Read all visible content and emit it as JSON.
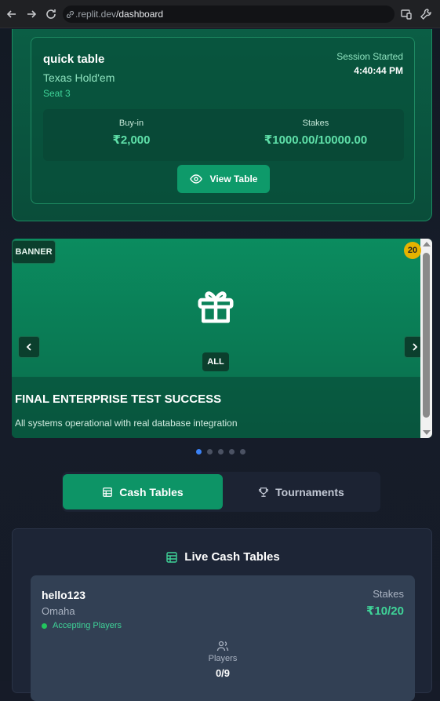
{
  "browser": {
    "url_host": ".replit.dev",
    "url_path": "/dashboard"
  },
  "session": {
    "table_name": "quick table",
    "game_type": "Texas Hold'em",
    "seat": "Seat 3",
    "started_label": "Session Started",
    "started_time": "4:40:44 PM",
    "buyin_label": "Buy-in",
    "buyin_value": "₹2,000",
    "stakes_label": "Stakes",
    "stakes_value": "₹1000.00/10000.00",
    "view_button": "View Table"
  },
  "banner": {
    "tag": "BANNER",
    "badge_count": "20",
    "category": "ALL",
    "title": "FINAL ENTERPRISE TEST SUCCESS",
    "description": "All systems operational with real database integration",
    "slides_total": 5,
    "active_slide": 1
  },
  "tabs": {
    "cash": "Cash Tables",
    "tournaments": "Tournaments",
    "active": "cash"
  },
  "live": {
    "title": "Live Cash Tables",
    "tables": [
      {
        "name": "hello123",
        "game": "Omaha",
        "status": "Accepting Players",
        "stakes_label": "Stakes",
        "stakes_value": "₹10/20",
        "players_label": "Players",
        "players_value": "0/9"
      }
    ]
  },
  "colors": {
    "accent_green": "#0d9466",
    "accent_text_green": "#3fd398",
    "active_dot": "#3b82f6",
    "badge_yellow": "#e7b300"
  }
}
